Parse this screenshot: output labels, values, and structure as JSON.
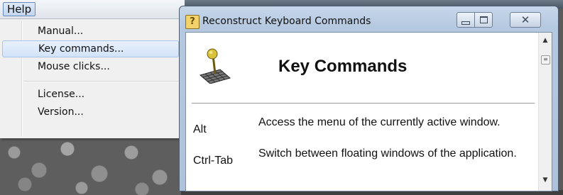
{
  "menubar": {
    "help_label": "Help"
  },
  "help_menu": {
    "items": [
      {
        "label": "Manual..."
      },
      {
        "label": "Key commands..."
      },
      {
        "label": "Mouse clicks..."
      },
      {
        "label": "License..."
      },
      {
        "label": "Version..."
      }
    ],
    "highlighted_index": 1
  },
  "window": {
    "title": "Reconstruct Keyboard Commands",
    "heading": "Key Commands",
    "commands": [
      {
        "key": "Alt",
        "description": "Access the menu of the currently active window."
      },
      {
        "key": "Ctrl-Tab",
        "description": "Switch between floating windows of the application."
      }
    ]
  },
  "icons": {
    "title_icon": "help-book-icon",
    "logo": "reconstruct-logo-icon",
    "minimize": "minimize-icon",
    "maximize": "maximize-icon",
    "close": "close-icon"
  },
  "colors": {
    "menu_highlight": "#d3e3f8",
    "titlebar": "#b4c8df"
  }
}
